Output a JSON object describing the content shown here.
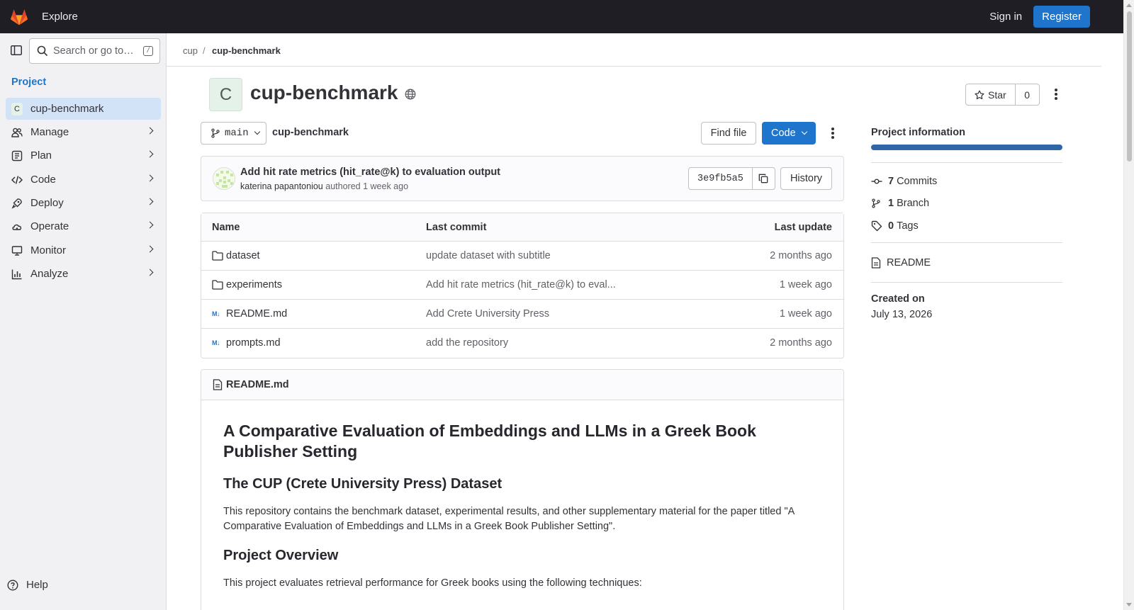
{
  "topbar": {
    "explore": "Explore",
    "sign_in": "Sign in",
    "register": "Register"
  },
  "sidebar": {
    "search_placeholder": "Search or go to…",
    "search_shortcut": "/",
    "section": "Project",
    "project_initial": "C",
    "project_name": "cup-benchmark",
    "items": [
      {
        "label": "Manage",
        "icon": "users-icon"
      },
      {
        "label": "Plan",
        "icon": "plan-icon"
      },
      {
        "label": "Code",
        "icon": "code-icon"
      },
      {
        "label": "Deploy",
        "icon": "rocket-icon"
      },
      {
        "label": "Operate",
        "icon": "cloud-gear-icon"
      },
      {
        "label": "Monitor",
        "icon": "monitor-icon"
      },
      {
        "label": "Analyze",
        "icon": "chart-icon"
      }
    ],
    "help": "Help"
  },
  "breadcrumb": {
    "group": "cup",
    "separator": "/",
    "project": "cup-benchmark"
  },
  "project": {
    "initial": "C",
    "title": "cup-benchmark",
    "star_label": "Star",
    "star_count": "0"
  },
  "repo": {
    "branch": "main",
    "path": "cup-benchmark",
    "find_file": "Find file",
    "code_button": "Code"
  },
  "commit": {
    "message": "Add hit rate metrics (hit_rate@k) to evaluation output",
    "author": "katerina papantoniou",
    "action": "authored",
    "time": "1 week ago",
    "sha": "3e9fb5a5",
    "history": "History"
  },
  "files": {
    "headers": {
      "name": "Name",
      "last_commit": "Last commit",
      "last_update": "Last update"
    },
    "rows": [
      {
        "type": "folder",
        "name": "dataset",
        "commit": "update dataset with subtitle",
        "updated": "2 months ago"
      },
      {
        "type": "folder",
        "name": "experiments",
        "commit": "Add hit rate metrics (hit_rate@k) to eval...",
        "updated": "1 week ago"
      },
      {
        "type": "markdown",
        "name": "README.md",
        "commit": "Add Crete University Press",
        "updated": "1 week ago"
      },
      {
        "type": "markdown",
        "name": "prompts.md",
        "commit": "add the repository",
        "updated": "2 months ago"
      }
    ]
  },
  "readme": {
    "filename": "README.md",
    "h1": "A Comparative Evaluation of Embeddings and LLMs in a Greek Book Publisher Setting",
    "h2_dataset": "The CUP (Crete University Press) Dataset",
    "p_dataset": "This repository contains the benchmark dataset, experimental results, and other supplementary material for the paper titled \"A Comparative Evaluation of Embeddings and LLMs in a Greek Book Publisher Setting\".",
    "h2_overview": "Project Overview",
    "p_overview": "This project evaluates retrieval performance for Greek books using the following techniques:"
  },
  "project_info": {
    "title": "Project information",
    "commits_count": "7",
    "commits_label": "Commits",
    "branches_count": "1",
    "branches_label": "Branch",
    "tags_count": "0",
    "tags_label": "Tags",
    "readme_link": "README",
    "created_label": "Created on",
    "created_date": "July 13, 2026"
  },
  "colors": {
    "topbar": "#1f1e24",
    "accent": "#1f75cb",
    "sidebar": "#f1f1f3",
    "active_item": "#d2e3f7"
  }
}
